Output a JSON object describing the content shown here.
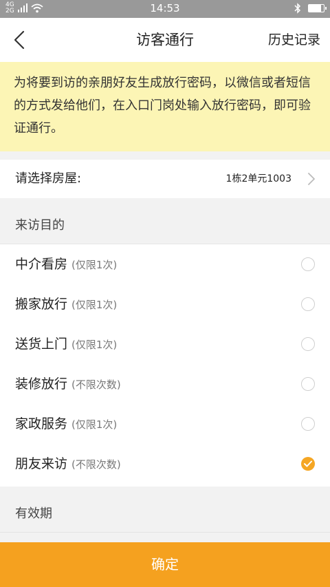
{
  "status_bar": {
    "network_label": "4G",
    "network_label_2": "2G",
    "time": "14:53",
    "battery_level": 0.8
  },
  "nav": {
    "title": "访客通行",
    "right_label": "历史记录",
    "back_icon": "chevron-left-icon"
  },
  "notice": {
    "text": "为将要到访的亲朋好友生成放行密码，以微信或者短信的方式发给他们，在入口门岗处输入放行密码，即可验证通行。"
  },
  "house": {
    "label": "请选择房屋:",
    "value": "1栋2单元1003"
  },
  "purpose": {
    "section_title": "来访目的",
    "items": [
      {
        "name": "中介看房",
        "limit": "(仅限1次)",
        "selected": false
      },
      {
        "name": "搬家放行",
        "limit": "(仅限1次)",
        "selected": false
      },
      {
        "name": "送货上门",
        "limit": "(仅限1次)",
        "selected": false
      },
      {
        "name": "装修放行",
        "limit": "(不限次数)",
        "selected": false
      },
      {
        "name": "家政服务",
        "limit": "(仅限1次)",
        "selected": false
      },
      {
        "name": "朋友来访",
        "limit": "(不限次数)",
        "selected": true
      }
    ]
  },
  "validity": {
    "section_title": "有效期"
  },
  "confirm_button": {
    "label": "确定"
  },
  "colors": {
    "accent": "#f5a11f",
    "notice_bg": "#fcf5b5",
    "status_bar": "#999999"
  }
}
